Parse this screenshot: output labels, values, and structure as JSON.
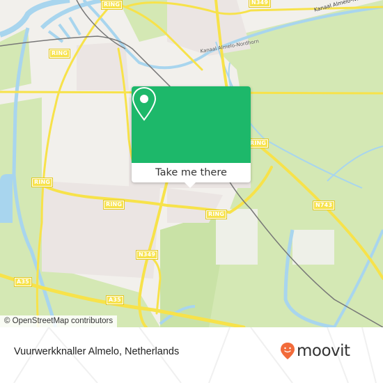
{
  "map": {
    "colors": {
      "land": "#f2f0ec",
      "urban": "#ebe5e3",
      "green": "#d4e8b4",
      "green_dark": "#c5e0a0",
      "water": "#a8d5ee",
      "road_major": "#f7e24a",
      "railway": "#777777"
    },
    "road_labels": [
      {
        "id": "ring-top",
        "text": "RING"
      },
      {
        "id": "n349-top",
        "text": "N349"
      },
      {
        "id": "ring-left",
        "text": "RING"
      },
      {
        "id": "ring-right",
        "text": "RING"
      },
      {
        "id": "ring-west",
        "text": "RING"
      },
      {
        "id": "ring-south-west",
        "text": "RING"
      },
      {
        "id": "ring-south-east",
        "text": "RING"
      },
      {
        "id": "n743",
        "text": "N743"
      },
      {
        "id": "n349",
        "text": "N349"
      },
      {
        "id": "a35-west",
        "text": "A35"
      },
      {
        "id": "a35-mid",
        "text": "A35"
      },
      {
        "id": "a35-bottom",
        "text": "A35"
      }
    ],
    "water_labels": [
      {
        "id": "kanaal-east",
        "text": "Kanaal Almelo-Nordhorn"
      },
      {
        "id": "kanaal-center",
        "text": "Kanaal Almelo-Nordhorn"
      }
    ],
    "attribution": "© OpenStreetMap contributors"
  },
  "popup": {
    "button_label": "Take me there",
    "icon": "map-pin-icon",
    "color": "#1db86a"
  },
  "footer": {
    "title": "Vuurwerkknaller Almelo, Netherlands",
    "brand": "moovit",
    "brand_icon": "moovit-pin-icon",
    "brand_color": "#f26b3a"
  }
}
